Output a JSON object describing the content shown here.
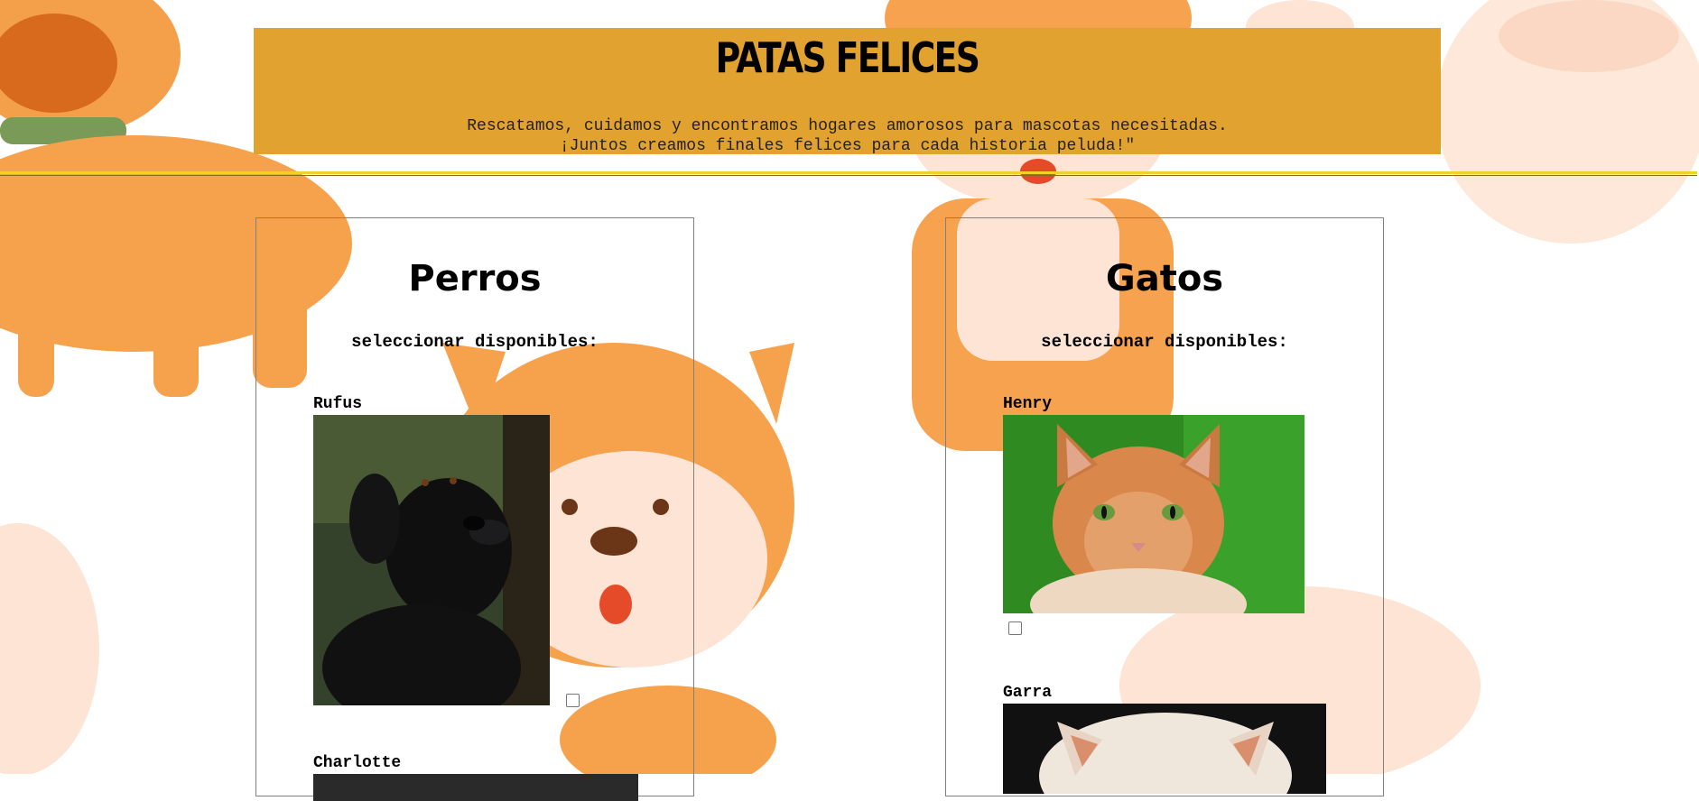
{
  "header": {
    "title": "PATAS FELICES",
    "subtitle_line1": "Rescatamos, cuidamos y encontramos hogares amorosos para mascotas necesitadas.",
    "subtitle_line2": "¡Juntos creamos finales felices para cada historia peluda!\""
  },
  "colors": {
    "header_bg": "#e2a22f",
    "divider": "#f3cf2a",
    "background_illustration": "#f7a04a"
  },
  "sections": {
    "dogs": {
      "title": "Perros",
      "select_label": "seleccionar disponibles:",
      "pets": [
        {
          "name": "Rufus",
          "checked": false
        },
        {
          "name": "Charlotte",
          "checked": false
        }
      ]
    },
    "cats": {
      "title": "Gatos",
      "select_label": "seleccionar disponibles:",
      "pets": [
        {
          "name": "Henry",
          "checked": false
        },
        {
          "name": "Garra",
          "checked": false
        }
      ]
    }
  }
}
